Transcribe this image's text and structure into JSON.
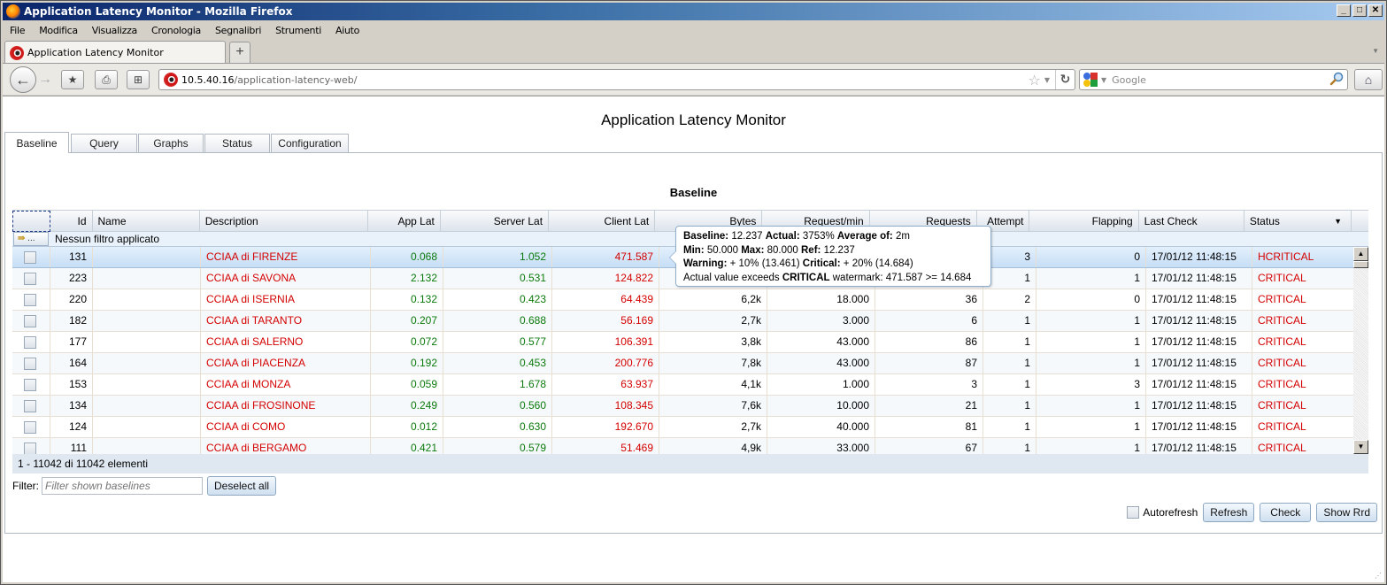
{
  "window": {
    "title": "Application Latency Monitor - Mozilla Firefox",
    "controls": {
      "minimize": "_",
      "maximize": "□",
      "close": "✕"
    }
  },
  "menu": [
    "File",
    "Modifica",
    "Visualizza",
    "Cronologia",
    "Segnalibri",
    "Strumenti",
    "Aiuto"
  ],
  "browser_tab": {
    "label": "Application Latency Monitor",
    "new_tab": "+"
  },
  "navbar": {
    "url_host": "10.5.40.16",
    "url_path": "/application-latency-web/",
    "search_placeholder": "Google"
  },
  "app": {
    "title": "Application Latency Monitor",
    "tabs": [
      "Baseline",
      "Query",
      "Graphs",
      "Status",
      "Configuration"
    ],
    "active_tab": "Baseline",
    "section_title": "Baseline"
  },
  "grid": {
    "columns": [
      "",
      "Id",
      "Name",
      "Description",
      "App Lat",
      "Server Lat",
      "Client Lat",
      "Bytes",
      "Request/min",
      "Requests",
      "Attempt",
      "Flapping",
      "Last Check",
      "Status"
    ],
    "filter_button": "...",
    "filter_text": "Nessun filtro applicato",
    "rows": [
      {
        "id": "131",
        "name": "",
        "description": "CCIAA di FIRENZE",
        "app_lat": "0.068",
        "server_lat": "1.052",
        "client_lat": "471.587",
        "bytes": "",
        "req_min": "",
        "requests": "",
        "attempt": "3",
        "flapping": "0",
        "last_check": "17/01/12 11:48:15",
        "status": "HCRITICAL",
        "selected": true
      },
      {
        "id": "223",
        "name": "",
        "description": "CCIAA di SAVONA",
        "app_lat": "2.132",
        "server_lat": "0.531",
        "client_lat": "124.822",
        "bytes": "",
        "req_min": "",
        "requests": "",
        "attempt": "1",
        "flapping": "1",
        "last_check": "17/01/12 11:48:15",
        "status": "CRITICAL"
      },
      {
        "id": "220",
        "name": "",
        "description": "CCIAA di ISERNIA",
        "app_lat": "0.132",
        "server_lat": "0.423",
        "client_lat": "64.439",
        "bytes": "6,2k",
        "req_min": "18.000",
        "requests": "36",
        "attempt": "2",
        "flapping": "0",
        "last_check": "17/01/12 11:48:15",
        "status": "CRITICAL"
      },
      {
        "id": "182",
        "name": "",
        "description": "CCIAA di TARANTO",
        "app_lat": "0.207",
        "server_lat": "0.688",
        "client_lat": "56.169",
        "bytes": "2,7k",
        "req_min": "3.000",
        "requests": "6",
        "attempt": "1",
        "flapping": "1",
        "last_check": "17/01/12 11:48:15",
        "status": "CRITICAL"
      },
      {
        "id": "177",
        "name": "",
        "description": "CCIAA di SALERNO",
        "app_lat": "0.072",
        "server_lat": "0.577",
        "client_lat": "106.391",
        "bytes": "3,8k",
        "req_min": "43.000",
        "requests": "86",
        "attempt": "1",
        "flapping": "1",
        "last_check": "17/01/12 11:48:15",
        "status": "CRITICAL"
      },
      {
        "id": "164",
        "name": "",
        "description": "CCIAA di PIACENZA",
        "app_lat": "0.192",
        "server_lat": "0.453",
        "client_lat": "200.776",
        "bytes": "7,8k",
        "req_min": "43.000",
        "requests": "87",
        "attempt": "1",
        "flapping": "1",
        "last_check": "17/01/12 11:48:15",
        "status": "CRITICAL"
      },
      {
        "id": "153",
        "name": "",
        "description": "CCIAA di MONZA",
        "app_lat": "0.059",
        "server_lat": "1.678",
        "client_lat": "63.937",
        "bytes": "4,1k",
        "req_min": "1.000",
        "requests": "3",
        "attempt": "1",
        "flapping": "3",
        "last_check": "17/01/12 11:48:15",
        "status": "CRITICAL"
      },
      {
        "id": "134",
        "name": "",
        "description": "CCIAA di FROSINONE",
        "app_lat": "0.249",
        "server_lat": "0.560",
        "client_lat": "108.345",
        "bytes": "7,6k",
        "req_min": "10.000",
        "requests": "21",
        "attempt": "1",
        "flapping": "1",
        "last_check": "17/01/12 11:48:15",
        "status": "CRITICAL"
      },
      {
        "id": "124",
        "name": "",
        "description": "CCIAA di COMO",
        "app_lat": "0.012",
        "server_lat": "0.630",
        "client_lat": "192.670",
        "bytes": "2,7k",
        "req_min": "40.000",
        "requests": "81",
        "attempt": "1",
        "flapping": "1",
        "last_check": "17/01/12 11:48:15",
        "status": "CRITICAL"
      },
      {
        "id": "111",
        "name": "",
        "description": "CCIAA di BERGAMO",
        "app_lat": "0.421",
        "server_lat": "0.579",
        "client_lat": "51.469",
        "bytes": "4,9k",
        "req_min": "33.000",
        "requests": "67",
        "attempt": "1",
        "flapping": "1",
        "last_check": "17/01/12 11:48:15",
        "status": "CRITICAL"
      }
    ],
    "footer": "1 - 11042 di 11042 elementi"
  },
  "tooltip": {
    "line1": [
      {
        "b": "Baseline:"
      },
      {
        "t": " 12.237 "
      },
      {
        "b": "Actual:"
      },
      {
        "t": " 3753% "
      },
      {
        "b": "Average of:"
      },
      {
        "t": " 2m"
      }
    ],
    "line2": [
      {
        "b": "Min:"
      },
      {
        "t": " 50.000 "
      },
      {
        "b": "Max:"
      },
      {
        "t": " 80.000 "
      },
      {
        "b": "Ref:"
      },
      {
        "t": " 12.237"
      }
    ],
    "line3": [
      {
        "b": "Warning:"
      },
      {
        "t": " + 10% (13.461) "
      },
      {
        "b": "Critical:"
      },
      {
        "t": " + 20% (14.684)"
      }
    ],
    "line4": [
      {
        "t": "Actual value exceeds "
      },
      {
        "b": "CRITICAL"
      },
      {
        "t": " watermark: 471.587 >= 14.684"
      }
    ]
  },
  "filter": {
    "label": "Filter:",
    "placeholder": "Filter shown baselines",
    "value": ""
  },
  "buttons": {
    "deselect_all": "Deselect all",
    "autorefresh": "Autorefresh",
    "refresh": "Refresh",
    "check": "Check",
    "show_rrd": "Show Rrd"
  },
  "colors": {
    "critical": "#d40000",
    "ok_latency": "#0b7a0b",
    "selected_row": "#c6def6"
  }
}
